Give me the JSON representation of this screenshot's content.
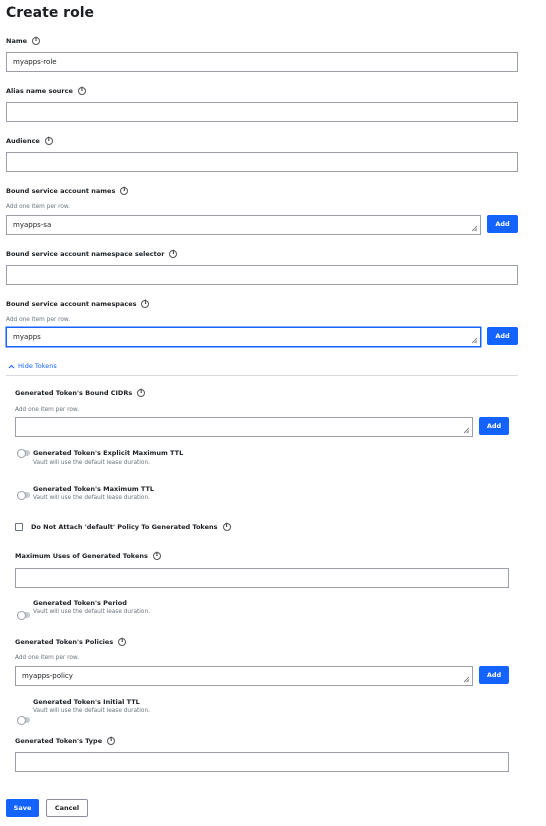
{
  "title": "Create role",
  "fields": {
    "name": {
      "label": "Name",
      "value": "myapps-role"
    },
    "alias": {
      "label": "Alias name source",
      "value": ""
    },
    "audience": {
      "label": "Audience",
      "value": ""
    },
    "bound_sa_names": {
      "label": "Bound service account names",
      "help": "Add one item per row.",
      "value": "myapps-sa",
      "add": "Add"
    },
    "ns_selector": {
      "label": "Bound service account namespace selector",
      "value": ""
    },
    "bound_sa_ns": {
      "label": "Bound service account namespaces",
      "help": "Add one item per row.",
      "value": "myapps",
      "add": "Add"
    }
  },
  "tokens": {
    "toggle_label": "Hide Tokens",
    "bound_cidrs": {
      "label": "Generated Token's Bound CIDRs",
      "help": "Add one item per row.",
      "value": "",
      "add": "Add"
    },
    "explicit_max_ttl": {
      "label": "Generated Token's Explicit Maximum TTL",
      "help": "Vault will use the default lease duration.",
      "enabled": false
    },
    "max_ttl": {
      "label": "Generated Token's Maximum TTL",
      "help": "Vault will use the default lease duration.",
      "enabled": false
    },
    "no_default_policy": {
      "label": "Do Not Attach 'default' Policy To Generated Tokens",
      "checked": false
    },
    "max_uses": {
      "label": "Maximum Uses of Generated Tokens",
      "value": ""
    },
    "period": {
      "label": "Generated Token's Period",
      "help": "Vault will use the default lease duration.",
      "enabled": false
    },
    "policies": {
      "label": "Generated Token's Policies",
      "help": "Add one item per row.",
      "value": "myapps-policy",
      "add": "Add"
    },
    "initial_ttl": {
      "label": "Generated Token's Initial TTL",
      "help": "Vault will use the default lease duration.",
      "enabled": false
    },
    "type": {
      "label": "Generated Token's Type",
      "value": ""
    }
  },
  "actions": {
    "save": "Save",
    "cancel": "Cancel"
  },
  "icons": {
    "info": "info-icon",
    "chevron": "chevron-up-icon",
    "grip": "resize-grip-icon"
  },
  "colors": {
    "primary": "#1563ff",
    "border": "#9aa0a6",
    "text": "#1b1f23",
    "muted": "#6a737d"
  }
}
